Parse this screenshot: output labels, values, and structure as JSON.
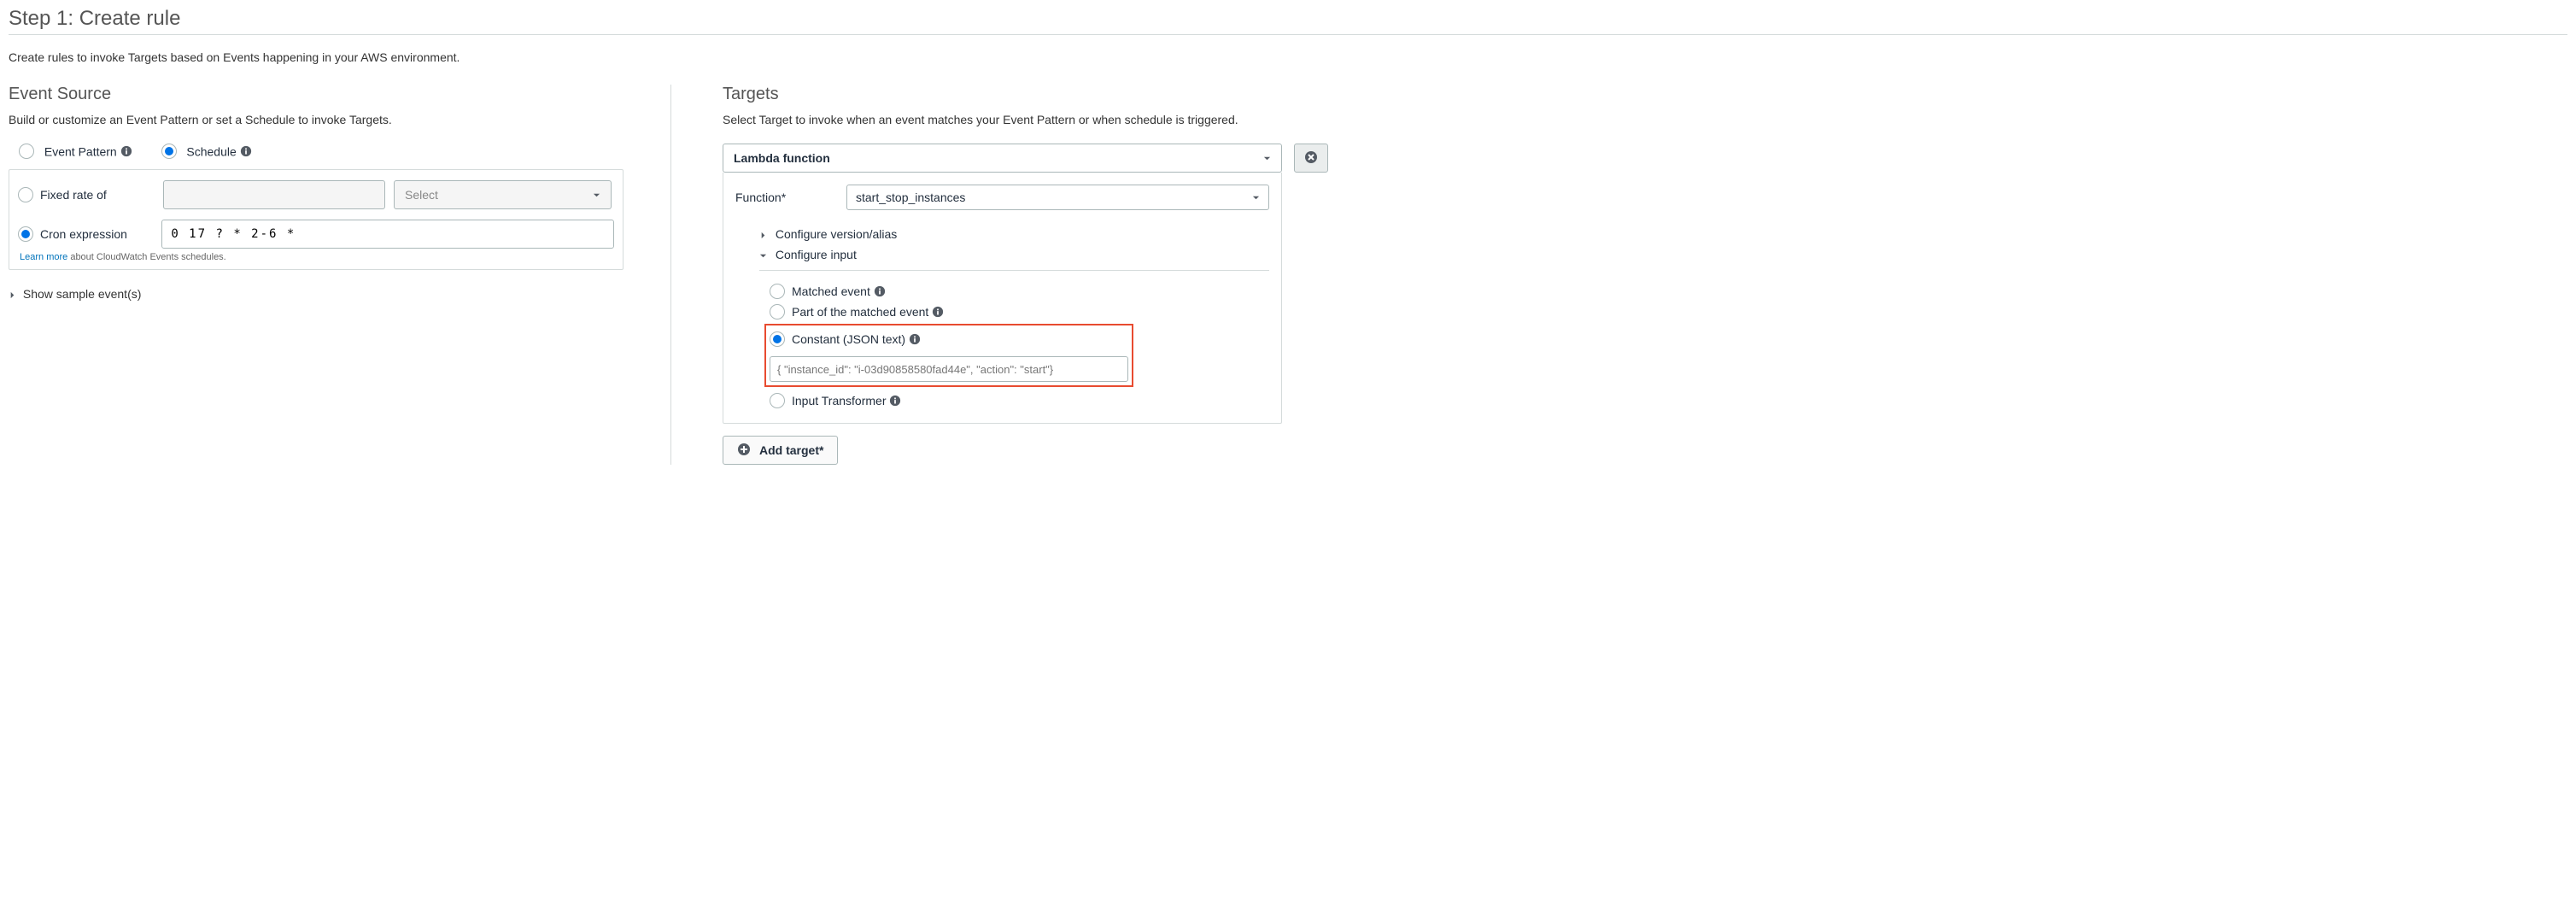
{
  "header": {
    "title": "Step 1: Create rule",
    "subtitle": "Create rules to invoke Targets based on Events happening in your AWS environment."
  },
  "event_source": {
    "title": "Event Source",
    "subtitle": "Build or customize an Event Pattern or set a Schedule to invoke Targets.",
    "pattern_or_schedule": {
      "event_pattern_label": "Event Pattern",
      "schedule_label": "Schedule",
      "selected": "schedule"
    },
    "schedule_kind": {
      "fixed_label": "Fixed rate of",
      "fixed_units_placeholder": "Select",
      "cron_label": "Cron expression",
      "selected": "cron"
    },
    "cron_value": "0 17 ? * 2-6 *",
    "learn_more_link": "Learn more",
    "learn_more_rest": " about CloudWatch Events schedules.",
    "sample_toggle": "Show sample event(s)"
  },
  "targets": {
    "title": "Targets",
    "subtitle": "Select Target to invoke when an event matches your Event Pattern or when schedule is triggered.",
    "target_type": "Lambda function",
    "function_label": "Function*",
    "function_value": "start_stop_instances",
    "configure_version_label": "Configure version/alias",
    "configure_input_label": "Configure input",
    "input_options": {
      "matched_event": "Matched event",
      "part_matched": "Part of the matched event",
      "constant_json": "Constant (JSON text)",
      "input_transformer": "Input Transformer",
      "selected": "constant_json"
    },
    "constant_json_value": "{ \"instance_id\": \"i-03d90858580fad44e\", \"action\": \"start\"}",
    "add_target_label": "Add target*"
  }
}
